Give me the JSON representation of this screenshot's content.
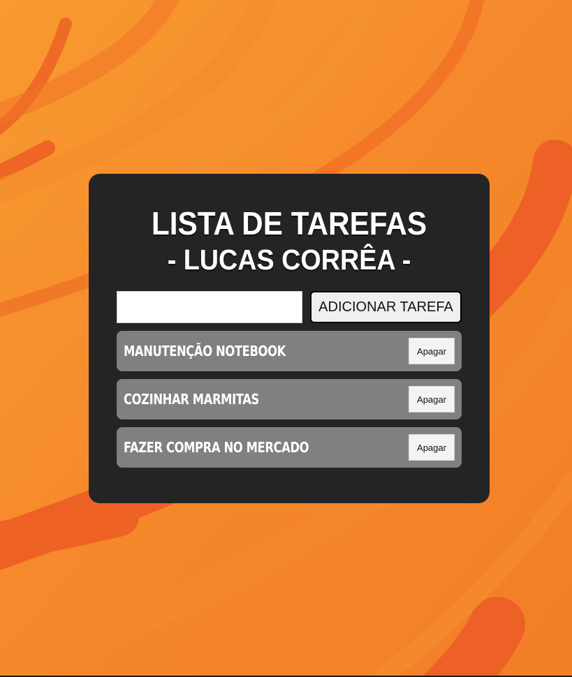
{
  "colors": {
    "background": "#f5872b",
    "stripe": "#ee6426",
    "card": "#252425",
    "task_item": "#808080",
    "title_text": "#ffffff"
  },
  "header": {
    "title_line1": "LISTA DE TAREFAS",
    "title_line2": "- LUCAS CORRÊA -"
  },
  "form": {
    "input_value": "",
    "input_placeholder": "",
    "add_button_label": "ADICIONAR TAREFA"
  },
  "tasks": [
    {
      "label": "MANUTENÇÃO NOTEBOOK",
      "delete_label": "Apagar"
    },
    {
      "label": "COZINHAR MARMITAS",
      "delete_label": "Apagar"
    },
    {
      "label": "FAZER COMPRA NO MERCADO",
      "delete_label": "Apagar"
    }
  ]
}
